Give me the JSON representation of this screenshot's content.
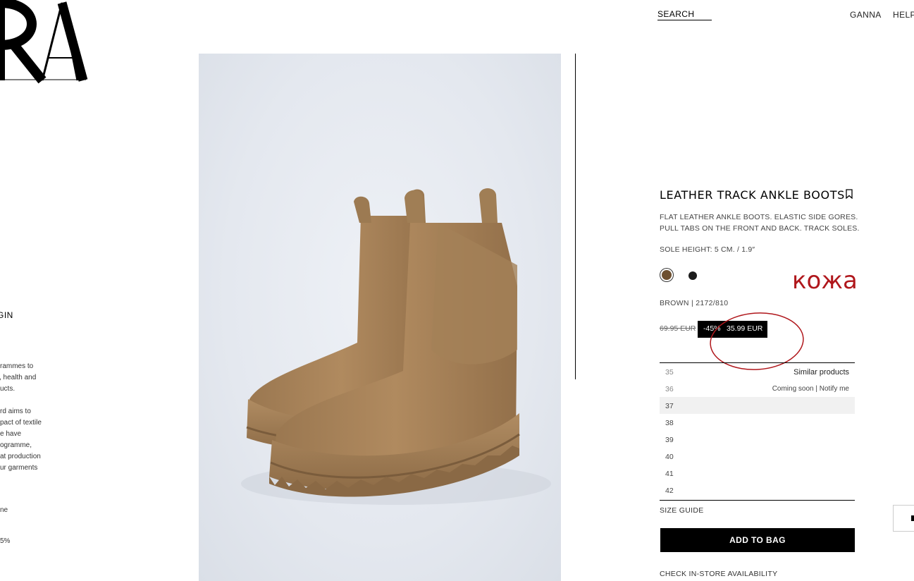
{
  "header": {
    "search_label": "SEARCH",
    "user_label": "GANNA",
    "help_label": "HELP"
  },
  "left_panel": {
    "origin_label": "RIGIN",
    "paragraph1": [
      "rammes to",
      ", health and",
      "ucts."
    ],
    "paragraph2": [
      "rd aims to",
      "pact of textile",
      "e have",
      "ogramme,",
      "at production",
      "ur garments"
    ],
    "line3": "ne",
    "line4": "5%"
  },
  "product": {
    "title": "LEATHER TRACK ANKLE BOOTS",
    "description": "FLAT LEATHER ANKLE BOOTS. ELASTIC SIDE GORES. PULL TABS ON THE FRONT AND BACK. TRACK SOLES.",
    "sole_height": "SOLE HEIGHT: 5 CM. / 1.9″",
    "annotation": "кожа",
    "color_info": "BROWN | 2172/810",
    "old_price": "69.95 EUR",
    "discount": "-45%",
    "price": "35.99 EUR",
    "swatch_colors": [
      "#6e5030",
      "#1c1c1c"
    ],
    "annotation_color": "#b0171c"
  },
  "sizes": {
    "similar_label": "Similar products",
    "coming_soon_note": "Coming soon | Notify me",
    "items": [
      "35",
      "36",
      "37",
      "38",
      "39",
      "40",
      "41",
      "42"
    ]
  },
  "actions": {
    "size_guide": "SIZE GUIDE",
    "add_to_bag": "ADD TO BAG",
    "check_store": "CHECK IN-STORE AVAILABILITY"
  }
}
